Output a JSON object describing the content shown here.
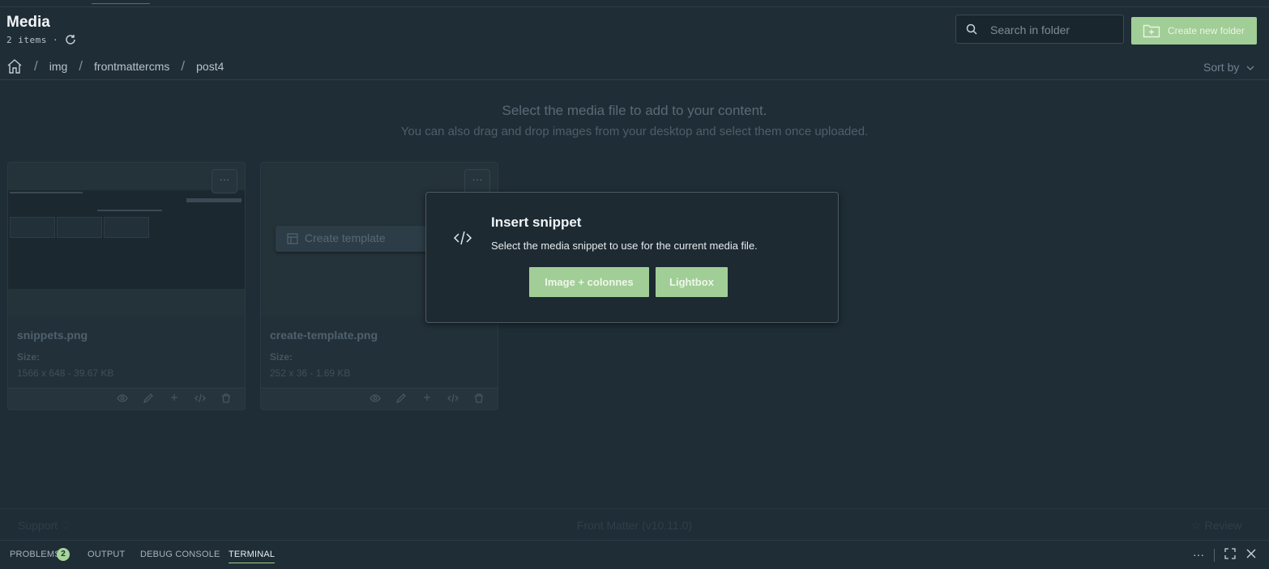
{
  "header": {
    "title": "Media",
    "item_count": "2 items ·",
    "search_placeholder": "Search in folder",
    "create_folder_label": "Create new folder",
    "sort_label": "Sort by"
  },
  "breadcrumb": [
    "img",
    "frontmattercms",
    "post4"
  ],
  "help": {
    "line1": "Select the media file to add to your content.",
    "line2": "You can also drag and drop images from your desktop and select them once uploaded."
  },
  "cards": [
    {
      "name": "snippets.png",
      "size_label": "Size:",
      "size_value": "1566 x 648 - 39.67 KB"
    },
    {
      "name": "create-template.png",
      "size_label": "Size:",
      "size_value": "252 x 36 - 1.69 KB",
      "preview_text": "Create template"
    }
  ],
  "card_menu": "···",
  "modal": {
    "title": "Insert snippet",
    "description": "Select the media snippet to use for the current media file.",
    "buttons": [
      "Image + colonnes",
      "Lightbox"
    ]
  },
  "footer": {
    "support": "Support",
    "version": "Front Matter (v10.11.0)",
    "review": "Review"
  },
  "panel": {
    "tabs": [
      "PROBLEMS",
      "OUTPUT",
      "DEBUG CONSOLE",
      "TERMINAL"
    ],
    "problems_count": "2",
    "active_tab": "TERMINAL",
    "more": "···"
  },
  "colors": {
    "background": "#1f2d36",
    "accent_button": "#a1cd96",
    "active_tab_underline": "#9ad08c"
  }
}
